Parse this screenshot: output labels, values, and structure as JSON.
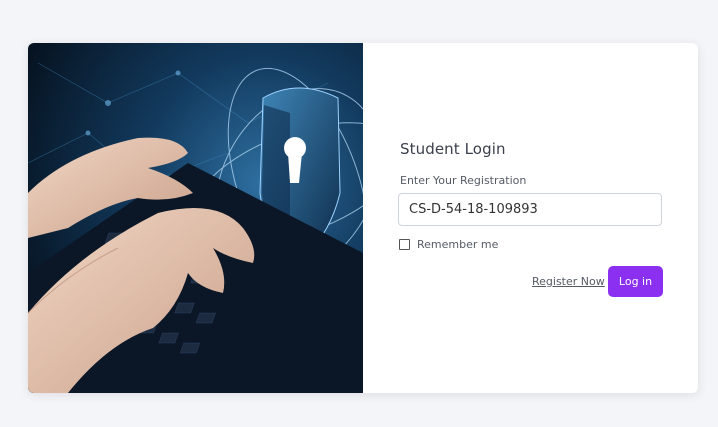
{
  "login": {
    "title": "Student Login",
    "registration_label": "Enter Your Registration",
    "registration_value": "CS-D-54-18-109893",
    "remember_label": "Remember me",
    "remember_checked": false,
    "register_link": "Register Now",
    "login_button": "Log in"
  },
  "colors": {
    "page_background": "#f4f5f8",
    "accent": "#8b2ff0",
    "hero_dark": "#0b1e33",
    "hero_glow": "#5aa9e0"
  },
  "icons": {
    "hero": "cyber-security-shield-keyhole-illustration"
  }
}
